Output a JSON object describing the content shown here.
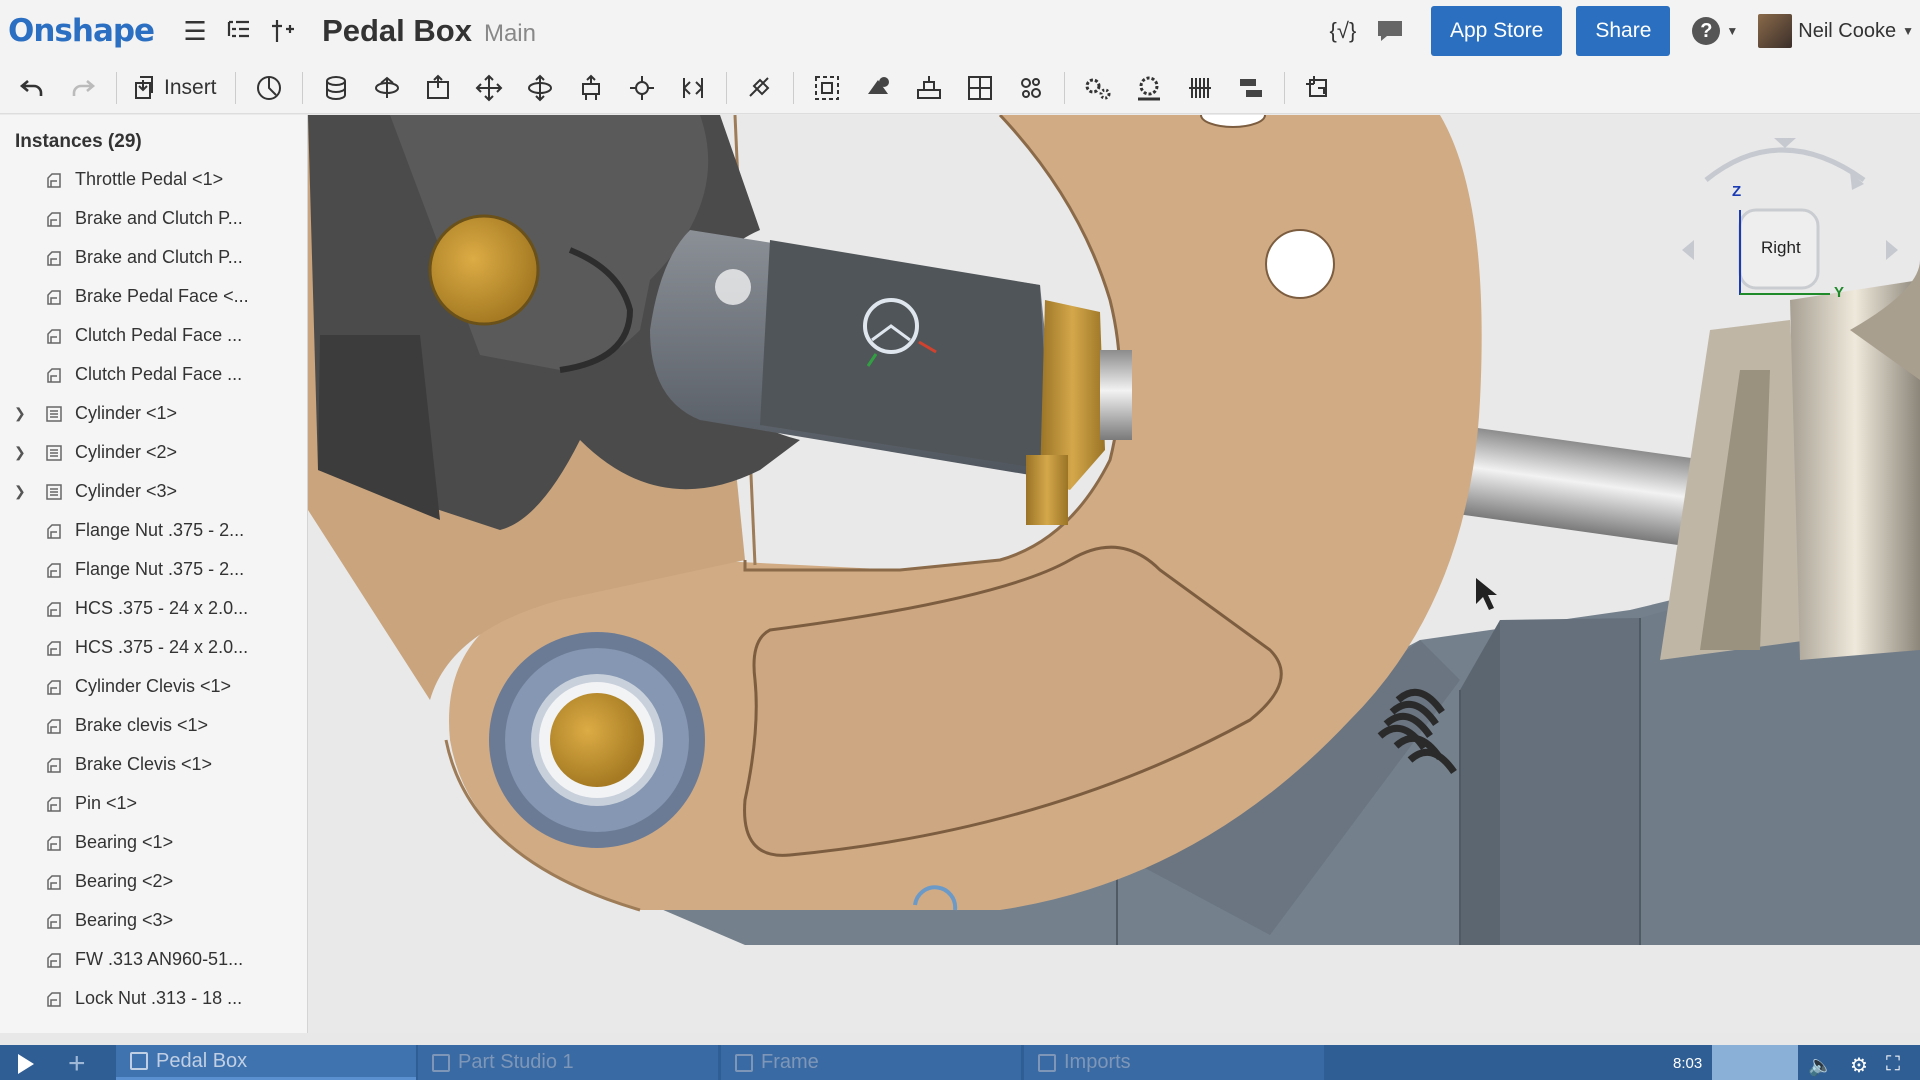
{
  "header": {
    "logo": "Onshape",
    "doc_title": "Pedal Box",
    "branch": "Main",
    "buttons": {
      "app_store": "App Store",
      "share": "Share"
    },
    "user": "Neil Cooke"
  },
  "toolbar": {
    "insert_label": "Insert",
    "icons": [
      "undo-icon",
      "redo-icon",
      "insert-icon",
      "mate-connector-icon",
      "fastened-mate-icon",
      "revolute-mate-icon",
      "slider-mate-icon",
      "planar-mate-icon",
      "cylindrical-mate-icon",
      "pin-slot-mate-icon",
      "ball-mate-icon",
      "parallel-mate-icon",
      "tangent-mate-icon",
      "group-icon",
      "relations-icon",
      "replicate-icon",
      "pattern-icon",
      "explode-icon",
      "gear-relation-icon",
      "rack-pinion-icon",
      "screw-relation-icon",
      "linear-relation-icon",
      "mate-group-icon"
    ]
  },
  "panel": {
    "title": "Instances (29)",
    "items": [
      {
        "label": "Throttle Pedal <1>",
        "expandable": false
      },
      {
        "label": "Brake and Clutch P...",
        "expandable": false
      },
      {
        "label": "Brake and Clutch P...",
        "expandable": false
      },
      {
        "label": "Brake Pedal Face <...",
        "expandable": false
      },
      {
        "label": "Clutch Pedal Face ...",
        "expandable": false
      },
      {
        "label": "Clutch Pedal Face ...",
        "expandable": false
      },
      {
        "label": "Cylinder <1>",
        "expandable": true
      },
      {
        "label": "Cylinder <2>",
        "expandable": true
      },
      {
        "label": "Cylinder <3>",
        "expandable": true
      },
      {
        "label": "Flange Nut .375 - 2...",
        "expandable": false
      },
      {
        "label": "Flange Nut .375 - 2...",
        "expandable": false
      },
      {
        "label": "HCS .375 - 24 x 2.0...",
        "expandable": false
      },
      {
        "label": "HCS .375 - 24 x 2.0...",
        "expandable": false
      },
      {
        "label": "Cylinder Clevis <1>",
        "expandable": false
      },
      {
        "label": "Brake clevis <1>",
        "expandable": false
      },
      {
        "label": "Brake Clevis <1>",
        "expandable": false
      },
      {
        "label": "Pin <1>",
        "expandable": false
      },
      {
        "label": "Bearing <1>",
        "expandable": false
      },
      {
        "label": "Bearing <2>",
        "expandable": false
      },
      {
        "label": "Bearing <3>",
        "expandable": false
      },
      {
        "label": "FW .313 AN960-51...",
        "expandable": false
      },
      {
        "label": "Lock Nut .313 - 18 ..."
      }
    ]
  },
  "viewcube": {
    "face": "Right",
    "axis_z": "Z",
    "axis_y": "Y"
  },
  "tabs": [
    {
      "label": "Pedal Box",
      "active": true
    },
    {
      "label": "Part Studio 1",
      "active": false
    },
    {
      "label": "Frame",
      "active": false
    },
    {
      "label": "Imports",
      "active": false
    }
  ],
  "video": {
    "time": "8:03"
  },
  "colors": {
    "accent": "#2a6fc0",
    "plate": "#d2ad86",
    "steel": "#6f7a86",
    "brass": "#c79a3a"
  }
}
